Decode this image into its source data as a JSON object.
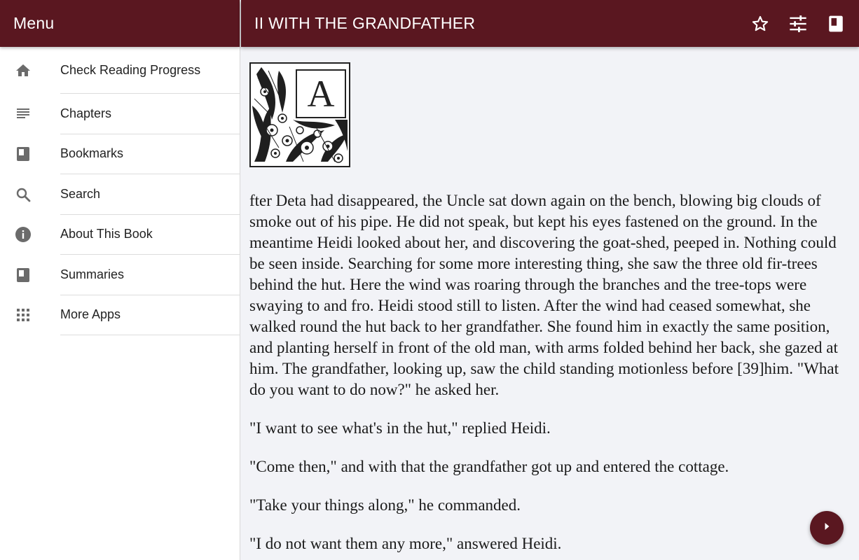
{
  "sidebar": {
    "title": "Menu",
    "items": [
      {
        "label": "Check Reading Progress",
        "icon": "home-icon"
      },
      {
        "label": "Chapters",
        "icon": "list-icon"
      },
      {
        "label": "Bookmarks",
        "icon": "book-icon"
      },
      {
        "label": "Search",
        "icon": "search-icon"
      },
      {
        "label": "About This Book",
        "icon": "info-icon"
      },
      {
        "label": "Summaries",
        "icon": "book-icon"
      },
      {
        "label": "More Apps",
        "icon": "apps-grid-icon"
      }
    ]
  },
  "header": {
    "chapter_title": "II WITH THE GRANDFATHER",
    "actions": [
      "star-icon",
      "tune-icon",
      "book-icon"
    ]
  },
  "content": {
    "drop_cap_letter": "A",
    "paragraphs": [
      "fter Deta had disappeared, the Uncle sat down again on the bench, blowing big clouds of smoke out of his pipe. He did not speak, but kept his eyes fastened on the ground. In the meantime Heidi looked about her, and discovering the goat-shed, peeped in. Nothing could be seen inside. Searching for some more interesting thing, she saw the three old fir-trees behind the hut. Here the wind was roaring through the branches and the tree-tops were swaying to and fro. Heidi stood still to listen. After the wind had ceased somewhat, she walked round the hut back to her grandfather. She found him in exactly the same position, and planting herself in front of the old man, with arms folded behind her back, she gazed at him. The grandfather, looking up, saw the child standing motionless before [39]him. \"What do you want to do now?\" he asked her.",
      "\"I want to see what's in the hut,\" replied Heidi.",
      "\"Come then,\" and with that the grandfather got up and entered the cottage.",
      "\"Take your things along,\" he commanded.",
      "\"I do not want them any more,\" answered Heidi."
    ]
  },
  "colors": {
    "primary": "#5a1720",
    "background": "#f2f3f7",
    "icon_gray": "#6b6b6b"
  }
}
